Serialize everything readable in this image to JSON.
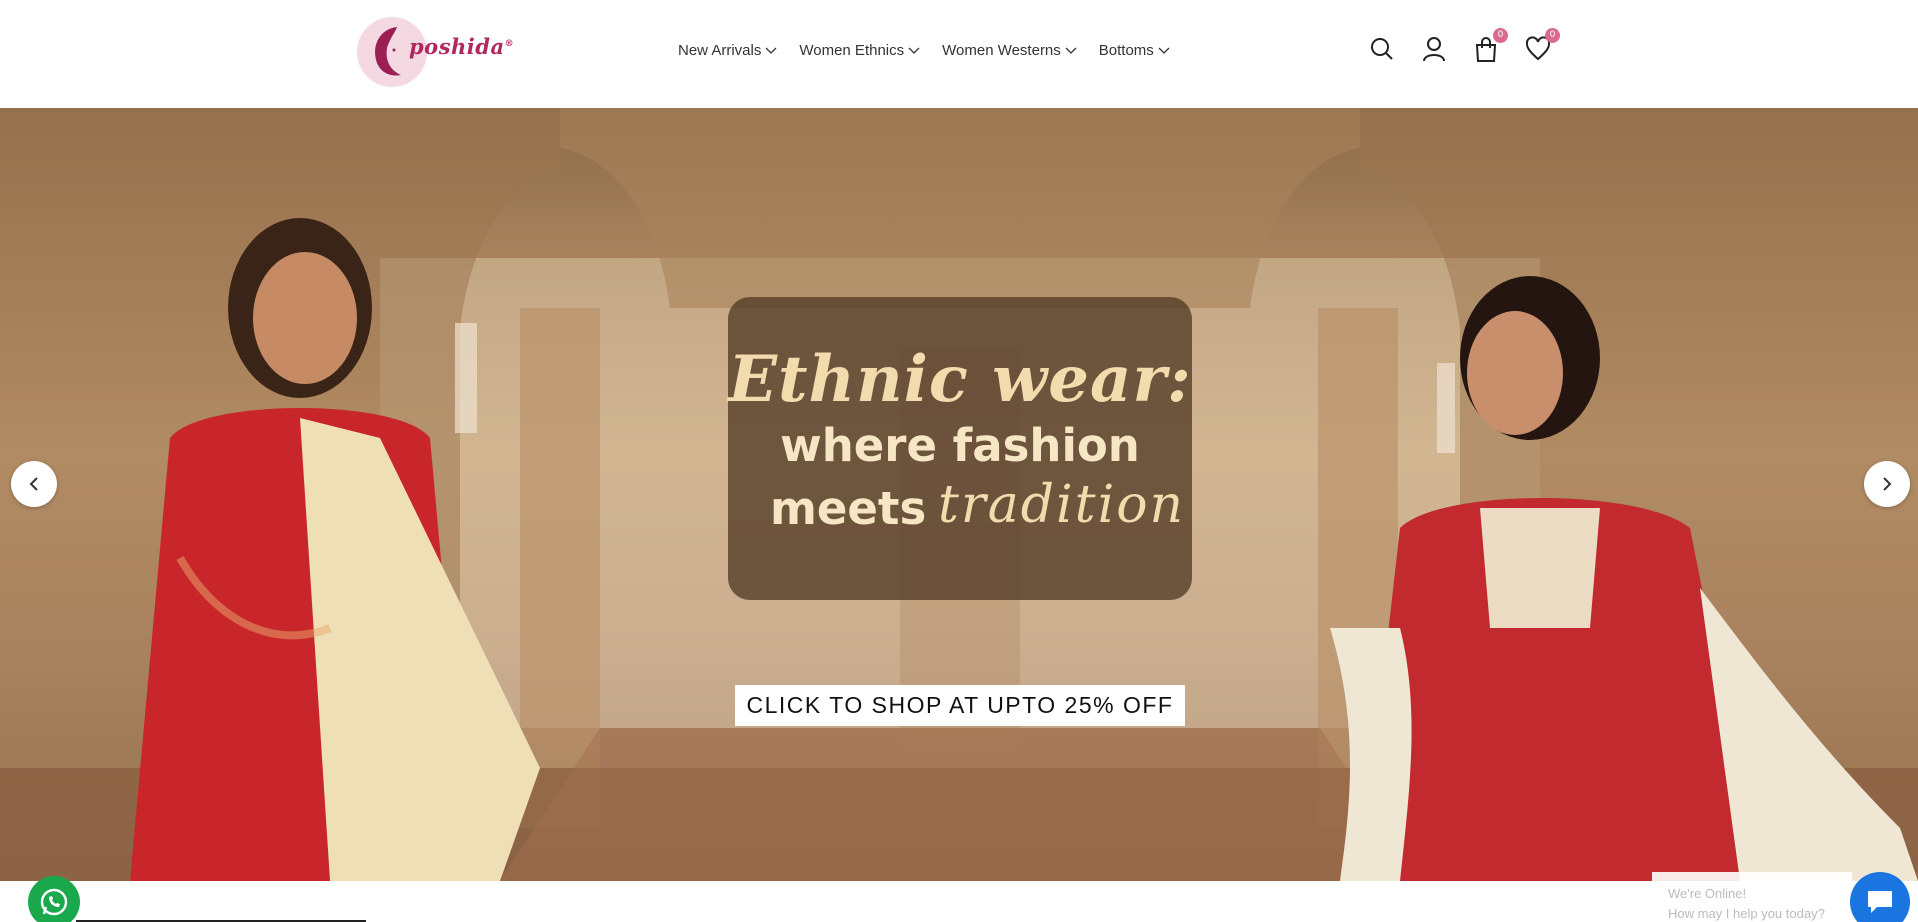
{
  "brand": {
    "logo_text": "poshida",
    "logo_mark": "®",
    "accent_color": "#b0285e"
  },
  "nav": {
    "items": [
      {
        "label": "New Arrivals"
      },
      {
        "label": "Women Ethnics"
      },
      {
        "label": "Women Westerns"
      },
      {
        "label": "Bottoms"
      }
    ]
  },
  "header_icons": {
    "search": "search-icon",
    "account": "user-icon",
    "cart": "shopping-bag-icon",
    "cart_count": "0",
    "wishlist": "heart-icon",
    "wishlist_count": "0"
  },
  "hero": {
    "headline_1": "Ethnic wear:",
    "headline_2": "where fashion",
    "headline_3": "meets",
    "headline_3_script": "tradition",
    "cta_label": "CLICK TO SHOP AT UPTO 25% OFF"
  },
  "chat": {
    "title": "We're Online!",
    "subtitle": "How may I help you today?",
    "button_color": "#1b75e0"
  },
  "whatsapp": {
    "color": "#1aa84d"
  }
}
